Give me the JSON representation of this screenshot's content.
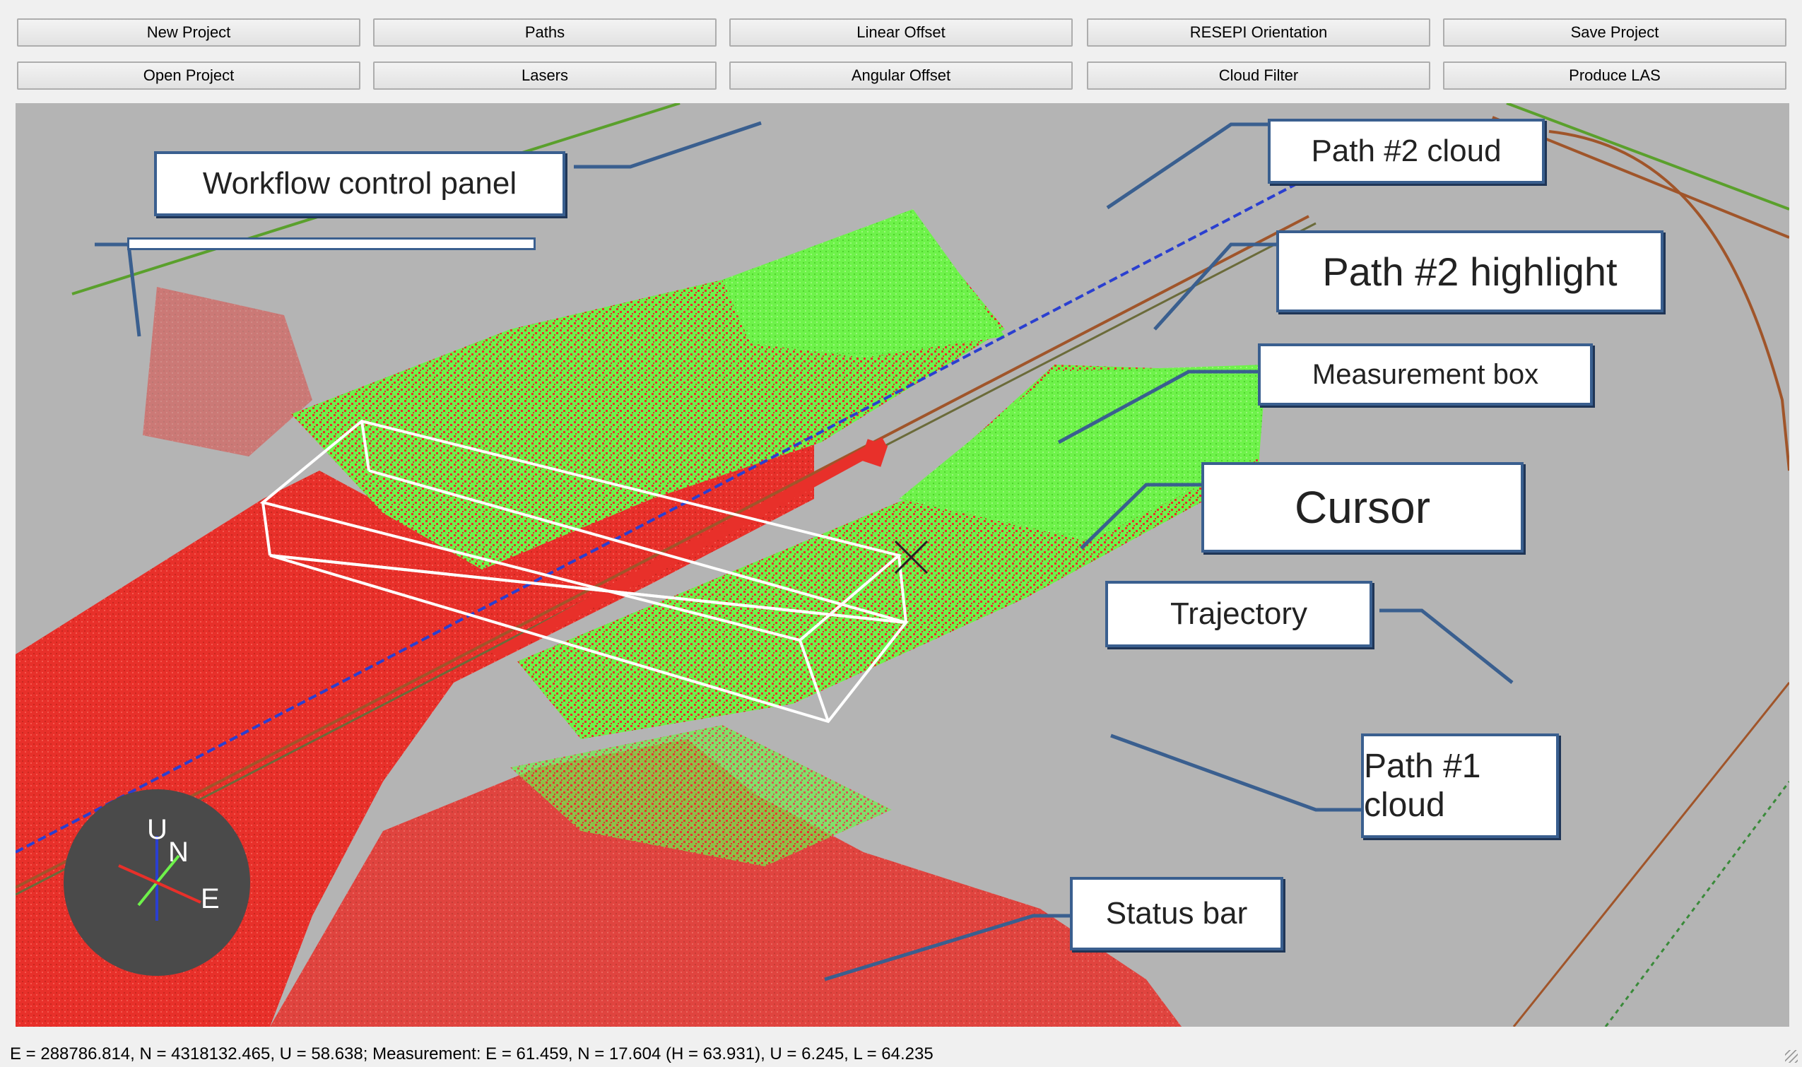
{
  "toolbar": {
    "row1": [
      "New Project",
      "Paths",
      "Linear Offset",
      "RESEPI Orientation",
      "Save Project"
    ],
    "row2": [
      "Open Project",
      "Lasers",
      "Angular Offset",
      "Cloud Filter",
      "Produce LAS"
    ]
  },
  "callouts": {
    "workflow": "Workflow control panel",
    "path2_cloud": "Path #2 cloud",
    "path2_highlight": "Path #2 highlight",
    "measurement_box": "Measurement box",
    "cursor": "Cursor",
    "trajectory": "Trajectory",
    "path1_cloud": "Path #1 cloud",
    "status_bar": "Status bar"
  },
  "gizmo": {
    "up": "U",
    "north": "N",
    "east": "E"
  },
  "status": "E = 288786.814, N = 4318132.465, U = 58.638; Measurement: E = 61.459, N = 17.604 (H = 63.931), U = 6.245, L = 64.235",
  "colors": {
    "path1_cloud": "#e8302a",
    "path2_cloud": "#6ef24a",
    "trajectory_blue": "#2a3fd0",
    "trajectory_brown": "#a0552a",
    "callout_border": "#3a5f8f",
    "viewport_bg": "#b4b4b4"
  }
}
